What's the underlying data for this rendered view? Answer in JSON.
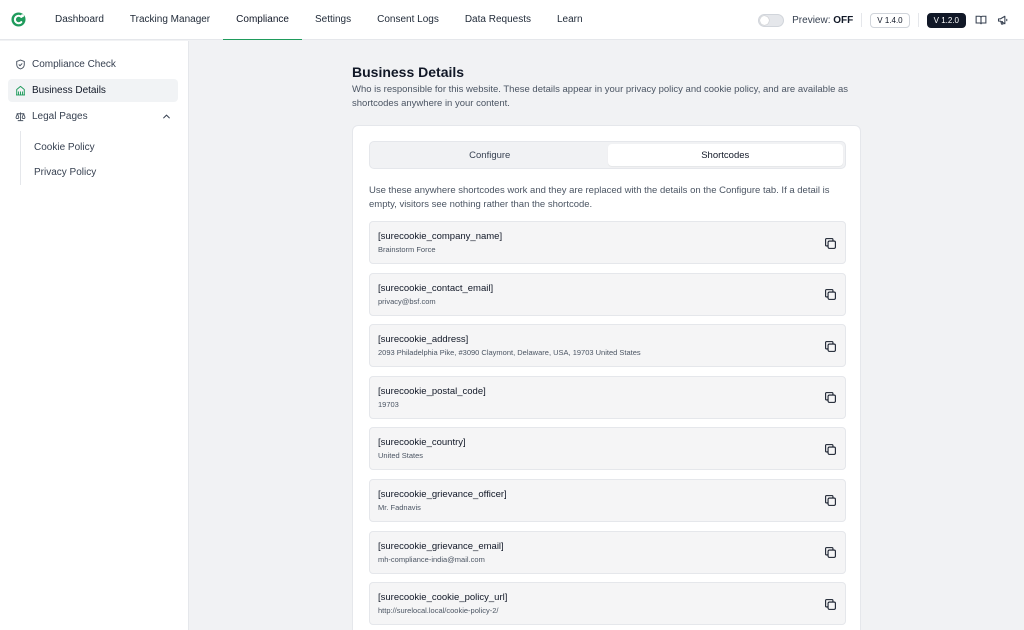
{
  "nav": {
    "items": [
      {
        "label": "Dashboard",
        "active": false
      },
      {
        "label": "Tracking Manager",
        "active": false
      },
      {
        "label": "Compliance",
        "active": true
      },
      {
        "label": "Settings",
        "active": false
      },
      {
        "label": "Consent Logs",
        "active": false
      },
      {
        "label": "Data Requests",
        "active": false
      },
      {
        "label": "Learn",
        "active": false
      }
    ],
    "preview_label": "Preview:",
    "preview_state": "OFF",
    "version_plugin": "V 1.4.0",
    "version_pro": "V 1.2.0",
    "accent_color": "#1f9b5c"
  },
  "sidebar": {
    "items": [
      {
        "label": "Compliance Check",
        "icon": "shield-check-icon"
      },
      {
        "label": "Business Details",
        "icon": "building-icon"
      },
      {
        "label": "Legal Pages",
        "icon": "scale-icon"
      }
    ],
    "subitems": [
      {
        "label": "Cookie Policy"
      },
      {
        "label": "Privacy Policy"
      }
    ]
  },
  "page": {
    "title": "Business Details",
    "description": "Who is responsible for this website. These details appear in your privacy policy and cookie policy, and are available as shortcodes anywhere in your content."
  },
  "tabs": {
    "configure": "Configure",
    "shortcodes": "Shortcodes"
  },
  "shortcodes_intro": "Use these anywhere shortcodes work and they are replaced with the details on the Configure tab. If a detail is empty, visitors see nothing rather than the shortcode.",
  "shortcodes": [
    {
      "code": "[surecookie_company_name]",
      "value": "Brainstorm Force"
    },
    {
      "code": "[surecookie_contact_email]",
      "value": "privacy@bsf.com"
    },
    {
      "code": "[surecookie_address]",
      "value": "2093 Philadelphia Pike, #3090 Claymont, Delaware, USA, 19703 United States"
    },
    {
      "code": "[surecookie_postal_code]",
      "value": "19703"
    },
    {
      "code": "[surecookie_country]",
      "value": "United States"
    },
    {
      "code": "[surecookie_grievance_officer]",
      "value": "Mr. Fadnavis"
    },
    {
      "code": "[surecookie_grievance_email]",
      "value": "mh-compliance-india@mail.com"
    },
    {
      "code": "[surecookie_cookie_policy_url]",
      "value": "http://surelocal.local/cookie-policy-2/"
    }
  ]
}
